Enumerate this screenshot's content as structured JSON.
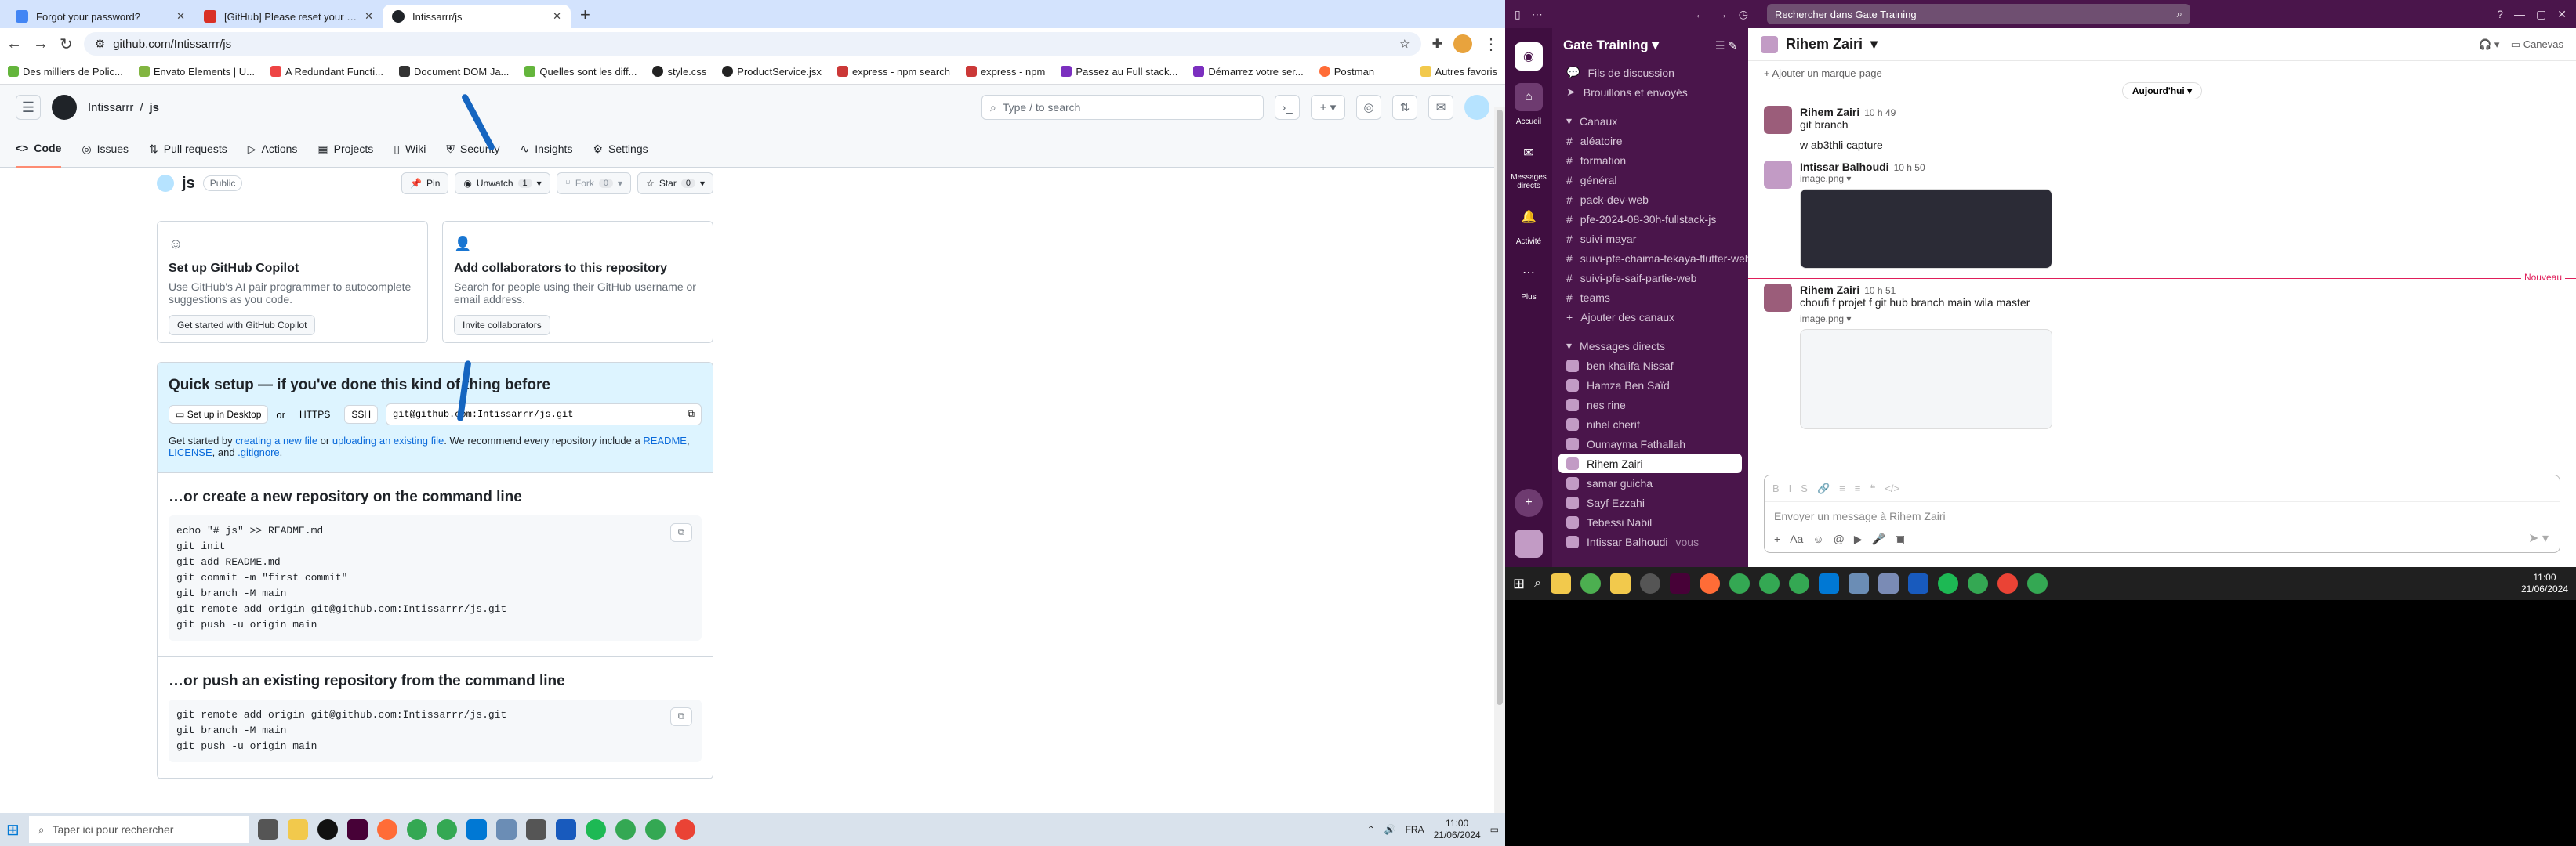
{
  "browser": {
    "tabs": [
      {
        "title": "Forgot your password?",
        "color": "#4285f4"
      },
      {
        "title": "[GitHub] Please reset your password",
        "color": "#d93025"
      },
      {
        "title": "Intissarrr/js",
        "color": "#1f2328"
      }
    ],
    "url": "github.com/Intissarrr/js",
    "bookmarks": [
      "Des milliers de Polic...",
      "Envato Elements | U...",
      "A Redundant Functi...",
      "Document DOM Ja...",
      "Quelles sont les diff...",
      "style.css",
      "ProductService.jsx",
      "express - npm search",
      "express - npm",
      "Passez au Full stack...",
      "Démarrez votre ser...",
      "Postman",
      "Autres favoris"
    ]
  },
  "github": {
    "owner": "Intissarrr",
    "repo": "js",
    "search_placeholder": "Type / to search",
    "nav_tabs": [
      "Code",
      "Issues",
      "Pull requests",
      "Actions",
      "Projects",
      "Wiki",
      "Security",
      "Insights",
      "Settings"
    ],
    "visibility": "Public",
    "actions": {
      "pin": "Pin",
      "unwatch": "Unwatch",
      "watch_count": "1",
      "fork": "Fork",
      "fork_count": "0",
      "star": "Star",
      "star_count": "0"
    },
    "copilot": {
      "title": "Set up GitHub Copilot",
      "desc": "Use GitHub's AI pair programmer to autocomplete suggestions as you code.",
      "button": "Get started with GitHub Copilot"
    },
    "collab": {
      "title": "Add collaborators to this repository",
      "desc": "Search for people using their GitHub username or email address.",
      "button": "Invite collaborators"
    },
    "quick_setup": {
      "title": "Quick setup — if you've done this kind of thing before",
      "desktop": "Set up in Desktop",
      "or": "or",
      "https": "HTTPS",
      "ssh": "SSH",
      "url": "git@github.com:Intissarrr/js.git",
      "getting_started": [
        "Get started by ",
        "creating a new file",
        " or ",
        "uploading an existing file",
        ". We recommend every repository include a ",
        "README",
        ", ",
        "LICENSE",
        ", and ",
        ".gitignore",
        "."
      ]
    },
    "new_repo": {
      "title": "…or create a new repository on the command line",
      "lines": [
        "echo \"# js\" >> README.md",
        "git init",
        "git add README.md",
        "git commit -m \"first commit\"",
        "git branch -M main",
        "git remote add origin git@github.com:Intissarrr/js.git",
        "git push -u origin main"
      ]
    },
    "push_existing": {
      "title": "…or push an existing repository from the command line",
      "lines": [
        "git remote add origin git@github.com:Intissarrr/js.git",
        "git branch -M main",
        "git push -u origin main"
      ]
    }
  },
  "taskbar_left": {
    "search": "Taper ici pour rechercher",
    "lang": "FRA",
    "time": "11:00",
    "date": "21/06/2024"
  },
  "slack": {
    "search": "Rechercher dans Gate Training",
    "workspace": "Gate Training",
    "rail": [
      "Accueil",
      "Messages directs",
      "Activité",
      "Plus"
    ],
    "top_items": [
      "Fils de discussion",
      "Brouillons et envoyés"
    ],
    "channels_header": "Canaux",
    "channels": [
      "aléatoire",
      "formation",
      "général",
      "pack-dev-web",
      "pfe-2024-08-30h-fullstack-js",
      "suivi-mayar",
      "suivi-pfe-chaima-tekaya-flutter-web",
      "suivi-pfe-saif-partie-web",
      "teams"
    ],
    "add_channels": "Ajouter des canaux",
    "dm_header": "Messages directs",
    "dms": [
      "ben khalifa Nissaf",
      "Hamza Ben Saïd",
      "nes rine",
      "nihel cherif",
      "Oumayma Fathallah",
      "Rihem Zairi",
      "samar guicha",
      "Sayf Ezzahi",
      "Tebessi Nabil",
      "Intissar Balhoudi"
    ],
    "dm_selected": "Rihem Zairi",
    "you_label": "vous",
    "conversation": "Rihem Zairi",
    "canvas": "Canevas",
    "bookmark": "+ Ajouter un marque-page",
    "date_divider": "Aujourd'hui",
    "new_label": "Nouveau",
    "messages": [
      {
        "author": "Rihem Zairi",
        "time": "10 h 49",
        "lines": [
          "git branch",
          "w ab3thli capture"
        ]
      },
      {
        "author": "Intissar Balhoudi",
        "time": "10 h 50",
        "attachment": "image.png"
      },
      {
        "author": "Rihem Zairi",
        "time": "10 h 51",
        "lines": [
          "choufi f projet  f git hub branch main wila master"
        ],
        "attachment": "image.png"
      }
    ],
    "composer_placeholder": "Envoyer un message à Rihem Zairi",
    "taskbar_time": "11:00",
    "taskbar_date": "21/06/2024"
  }
}
